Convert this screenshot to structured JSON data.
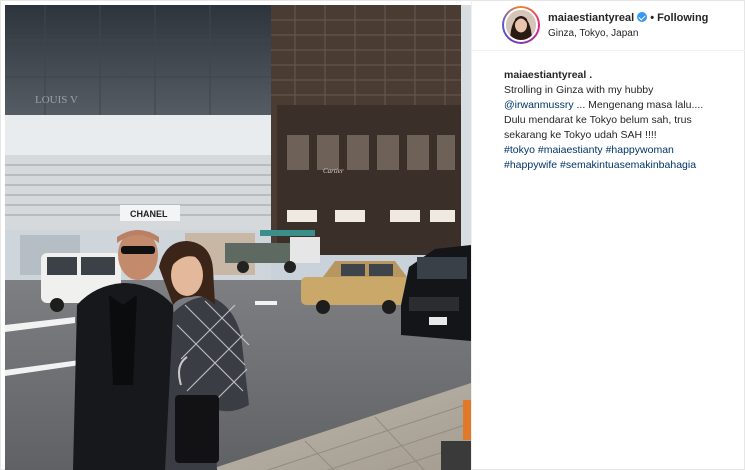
{
  "post": {
    "username": "maiaestiantyreal",
    "follow_status": "Following",
    "separator": "•",
    "location": "Ginza, Tokyo, Japan",
    "verified": true,
    "caption": {
      "user": "maiaestiantyreal .",
      "line1": "Strolling in Ginza with my hubby",
      "mention": "@irwanmussry",
      "line2_rest": " ... Mengenang masa lalu....",
      "line3": "Dulu mendarat ke Tokyo belum sah, trus",
      "line4": "sekarang ke Tokyo udah SAH !!!!",
      "hashtags_line1": [
        "#tokyo",
        "#maiaestianty",
        "#happywoman"
      ],
      "hashtags_line2": [
        "#happywife",
        "#semakintuasemakinbahagia"
      ]
    },
    "photo": {
      "sign_chanel": "CHANEL",
      "sign_louis": "LOUIS V",
      "sign_cartier": "Cartier"
    },
    "colors": {
      "link": "#003569",
      "verified": "#3897f0"
    }
  }
}
